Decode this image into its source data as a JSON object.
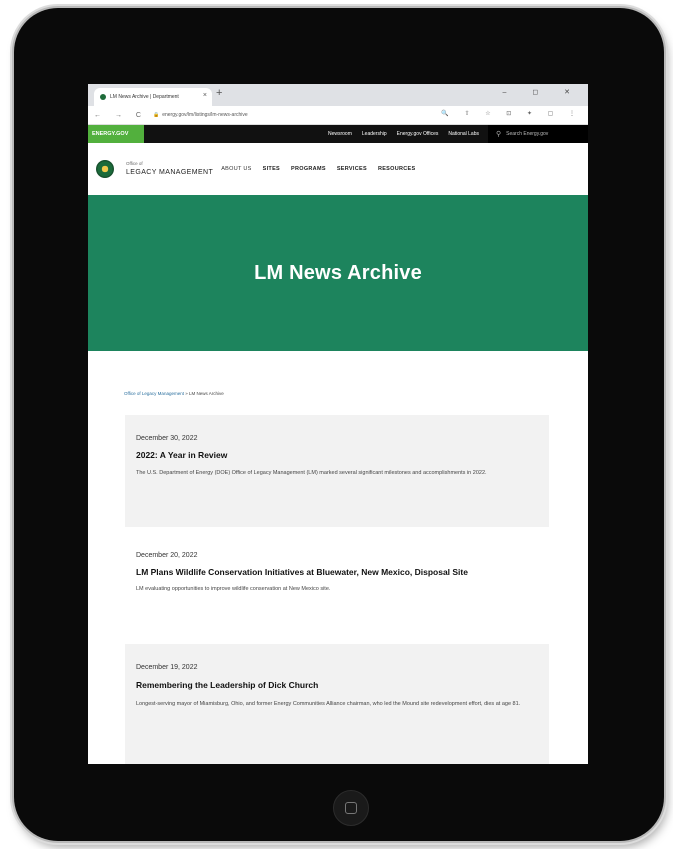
{
  "browser": {
    "tab_title": "LM News Archive | Department",
    "tab_close": "×",
    "new_tab": "+",
    "window_controls": "– ◻ ✕",
    "nav_buttons": "← → C",
    "url": "energy.gov/lm/listings/lm-news-archive",
    "address_icons": "🔍 ⇧ ☆ ⊡ ✦ ▢ ⋮"
  },
  "topnav": {
    "logo": "ENERGY.GOV",
    "links": [
      "Newsroom",
      "Leadership",
      "Energy.gov Offices",
      "National Labs"
    ],
    "search_placeholder": "Search Energy.gov"
  },
  "site_header": {
    "office_small": "Office of",
    "office_name": "LEGACY MANAGEMENT",
    "nav": [
      "ABOUT US",
      "SITES",
      "PROGRAMS",
      "SERVICES",
      "RESOURCES"
    ]
  },
  "hero": {
    "title": "LM News Archive"
  },
  "breadcrumb": {
    "home": "Office of Legacy Management",
    "separator": " » ",
    "current": "LM News Archive"
  },
  "rss_icon": "rss-icon",
  "articles": [
    {
      "date": "December 30, 2022",
      "title": "2022: A Year in Review",
      "description": "The U.S. Department of Energy (DOE) Office of Legacy Management (LM) marked several significant milestones and accomplishments in 2022."
    },
    {
      "date": "December 20, 2022",
      "title": "LM Plans Wildlife Conservation Initiatives at Bluewater, New Mexico, Disposal Site",
      "description": "LM evaluating opportunities to improve wildlife conservation at New Mexico site."
    },
    {
      "date": "December 19, 2022",
      "title": "Remembering the Leadership of Dick Church",
      "description": "Longest-serving mayor of Miamisburg, Ohio, and former Energy Communities Alliance chairman, who led the Mound site redevelopment effort, dies at age 81."
    }
  ],
  "colors": {
    "hero_green": "#1d845d",
    "energy_green": "#52b03d",
    "rss_orange": "#f3902f"
  }
}
